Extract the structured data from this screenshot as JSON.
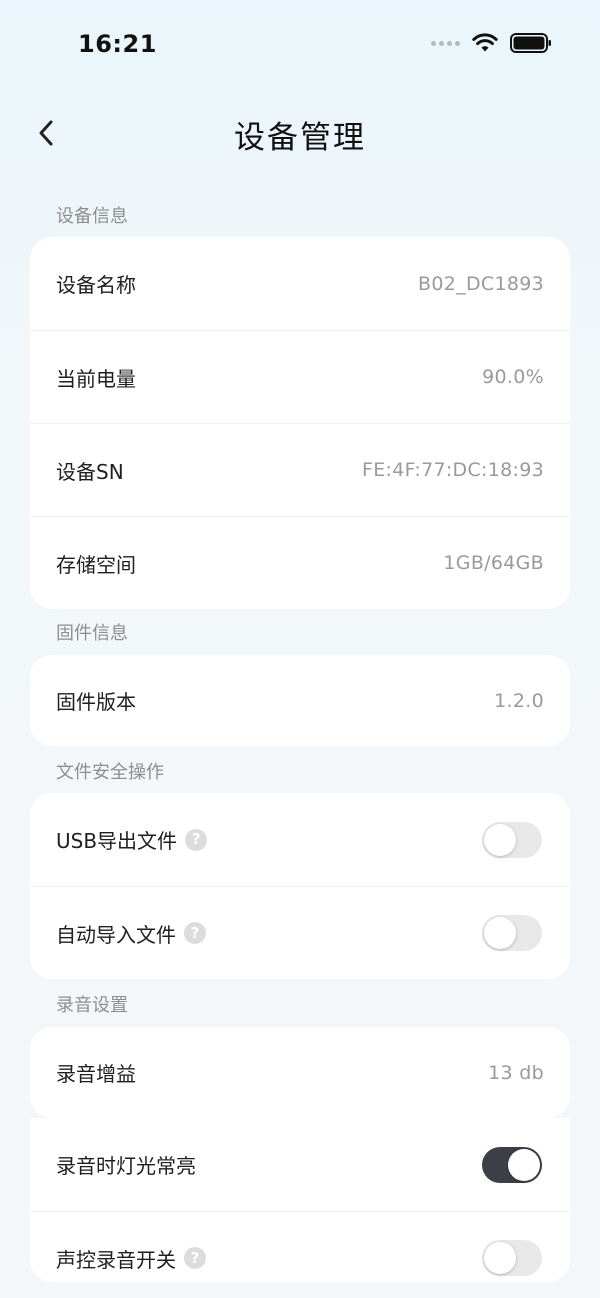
{
  "status_bar": {
    "time": "16:21"
  },
  "nav": {
    "title": "设备管理"
  },
  "sections": {
    "device_info": {
      "label": "设备信息",
      "rows": [
        {
          "label": "设备名称",
          "value": "B02_DC1893"
        },
        {
          "label": "当前电量",
          "value": "90.0%"
        },
        {
          "label": "设备SN",
          "value": "FE:4F:77:DC:18:93"
        },
        {
          "label": "存储空间",
          "value": "1GB/64GB"
        }
      ]
    },
    "firmware_info": {
      "label": "固件信息",
      "rows": [
        {
          "label": "固件版本",
          "value": "1.2.0"
        }
      ]
    },
    "file_security": {
      "label": "文件安全操作",
      "rows": [
        {
          "label": "USB导出文件",
          "help": "?",
          "toggle": false
        },
        {
          "label": "自动导入文件",
          "help": "?",
          "toggle": false
        }
      ]
    },
    "recording": {
      "label": "录音设置",
      "rows": [
        {
          "label": "录音增益",
          "value": "13 db"
        },
        {
          "label": "录音时灯光常亮",
          "toggle": true
        },
        {
          "label": "声控录音开关",
          "help": "?",
          "toggle": false
        }
      ]
    }
  }
}
